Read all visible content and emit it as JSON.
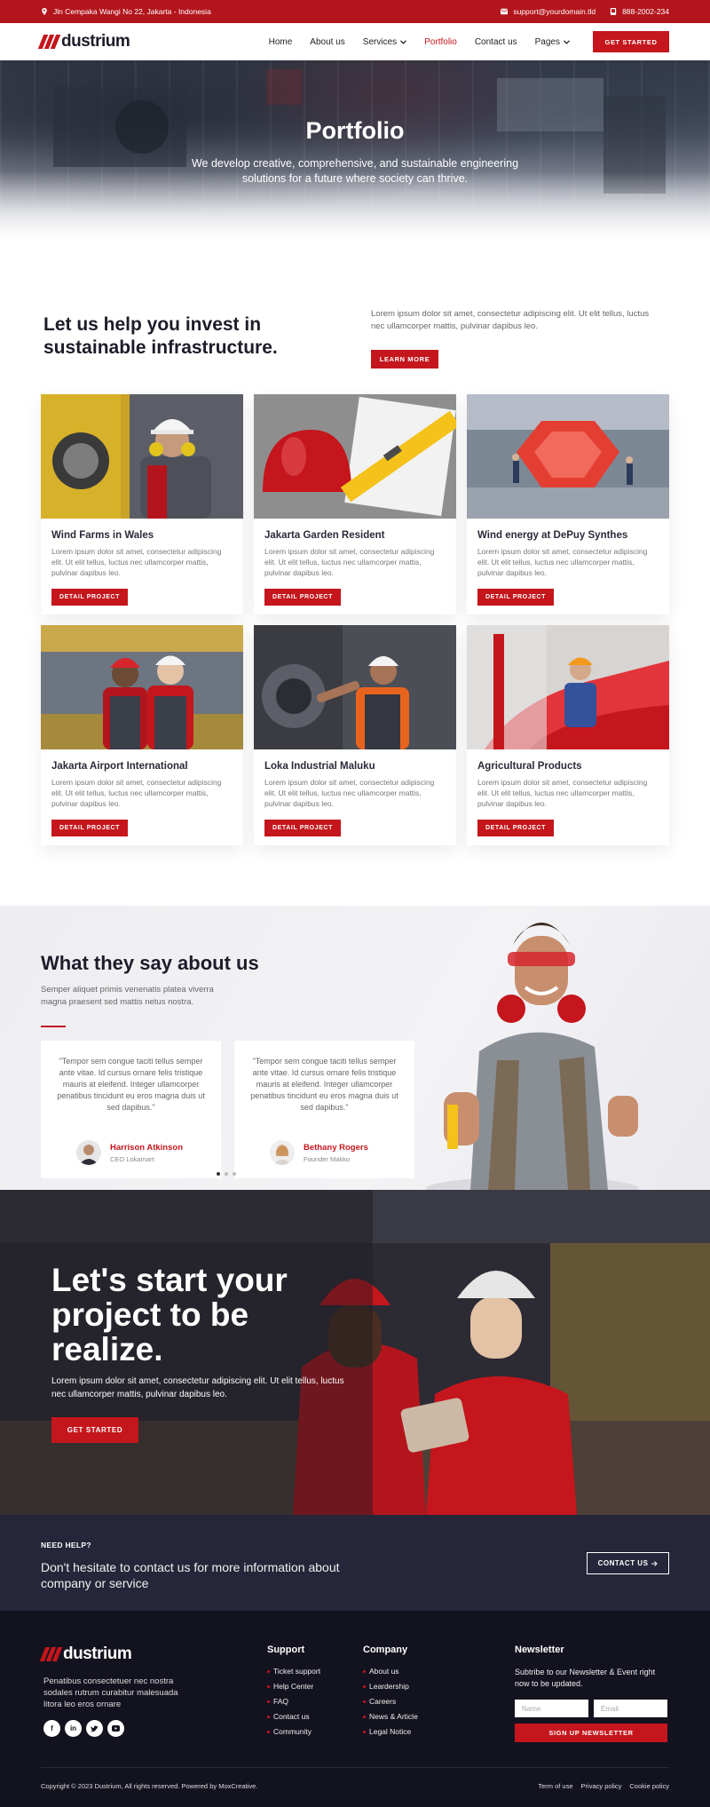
{
  "topbar": {
    "address": "Jln Cempaka Wangi No 22, Jakarta - Indonesia",
    "email": "support@yourdomain.tld",
    "phone": "888-2002-234"
  },
  "brand": {
    "name": "dustrium",
    "accent": "#c4161c",
    "dark": "#1c1c2a"
  },
  "nav": {
    "items": [
      {
        "label": "Home"
      },
      {
        "label": "About us"
      },
      {
        "label": "Services"
      },
      {
        "label": "Portfolio"
      },
      {
        "label": "Contact us"
      },
      {
        "label": "Pages"
      }
    ],
    "active": "Portfolio",
    "cta": "GET STARTED"
  },
  "hero": {
    "title": "Portfolio",
    "subtitle": "We develop creative, comprehensive, and sustainable engineering solutions for a future where society can thrive."
  },
  "intro": {
    "heading": "Let us help you invest in sustainable infrastructure.",
    "text": "Lorem ipsum dolor sit amet, consectetur adipiscing elit. Ut elit tellus, luctus nec ullamcorper mattis, pulvinar dapibus leo.",
    "button": "LEARN MORE"
  },
  "projects": [
    {
      "title": "Wind Farms in Wales",
      "text": "Lorem ipsum dolor sit amet, consectetur adipiscing elit. Ut elit tellus, luctus nec ullamcorper mattis, pulvinar dapibus leo.",
      "button": "DETAIL PROJECT"
    },
    {
      "title": "Jakarta Garden Resident",
      "text": "Lorem ipsum dolor sit amet, consectetur adipiscing elit. Ut elit tellus, luctus nec ullamcorper mattis, pulvinar dapibus leo.",
      "button": "DETAIL PROJECT"
    },
    {
      "title": "Wind energy at DePuy Synthes",
      "text": "Lorem ipsum dolor sit amet, consectetur adipiscing elit. Ut elit tellus, luctus nec ullamcorper mattis, pulvinar dapibus leo.",
      "button": "DETAIL PROJECT"
    },
    {
      "title": "Jakarta Airport International",
      "text": "Lorem ipsum dolor sit amet, consectetur adipiscing elit. Ut elit tellus, luctus nec ullamcorper mattis, pulvinar dapibus leo.",
      "button": "DETAIL PROJECT"
    },
    {
      "title": "Loka Industrial Maluku",
      "text": "Lorem ipsum dolor sit amet, consectetur adipiscing elit. Ut elit tellus, luctus nec ullamcorper mattis, pulvinar dapibus leo.",
      "button": "DETAIL PROJECT"
    },
    {
      "title": "Agricultural Products",
      "text": "Lorem ipsum dolor sit amet, consectetur adipiscing elit. Ut elit tellus, luctus nec ullamcorper mattis, pulvinar dapibus leo.",
      "button": "DETAIL PROJECT"
    }
  ],
  "testimonials": {
    "heading": "What they say about us",
    "subtitle": "Semper aliquet primis venenatis platea viverra magna praesent sed mattis netus nostra.",
    "items": [
      {
        "quote": "\"Tempor sem congue taciti tellus semper ante vitae. Id cursus ornare felis tristique mauris at eleifend. Integer ullamcorper penatibus tincidunt eu eros magna duis ut sed dapibus.\"",
        "name": "Harrison Atkinson",
        "role": "CEO Lokamart"
      },
      {
        "quote": "\"Tempor sem congue taciti tellus semper ante vitae. Id cursus ornare felis tristique mauris at eleifend. Integer ullamcorper penatibus tincidunt eu eros magna duis ut sed dapibus.\"",
        "name": "Bethany Rogers",
        "role": "Founder Makko"
      }
    ],
    "active_slide": 1,
    "slide_count": 3
  },
  "cta": {
    "heading": "Let's start your project to be realize.",
    "text": "Lorem ipsum dolor sit amet, consectetur adipiscing elit. Ut elit tellus, luctus nec ullamcorper mattis, pulvinar dapibus leo.",
    "button": "GET STARTED"
  },
  "help": {
    "kicker": "NEED HELP?",
    "text": "Don't hesitate to contact us for more information about company or service",
    "button": "CONTACT US"
  },
  "footer": {
    "description": "Penatibus consectetuer nec nostra sodales rutrum curabitur malesuada litora leo eros ornare",
    "social": [
      "facebook-icon",
      "linkedin-icon",
      "twitter-icon",
      "youtube-icon"
    ],
    "support": {
      "title": "Support",
      "links": [
        "Ticket support",
        "Help Center",
        "FAQ",
        "Contact us",
        "Community"
      ]
    },
    "company": {
      "title": "Company",
      "links": [
        "About us",
        "Leardership",
        "Careers",
        "News & Article",
        "Legal Notice"
      ]
    },
    "newsletter": {
      "title": "Newsletter",
      "text": "Subtribe to our Newsletter & Event right now to be updated.",
      "name_placeholder": "Name",
      "email_placeholder": "Email",
      "button": "SIGN UP NEWSLETTER"
    },
    "copyright": "Copyright © 2023 Dustrium, All rights reserved. Powered by MoxCreative.",
    "legal_links": [
      "Term of use",
      "Privacy policy",
      "Cookie policy"
    ]
  }
}
